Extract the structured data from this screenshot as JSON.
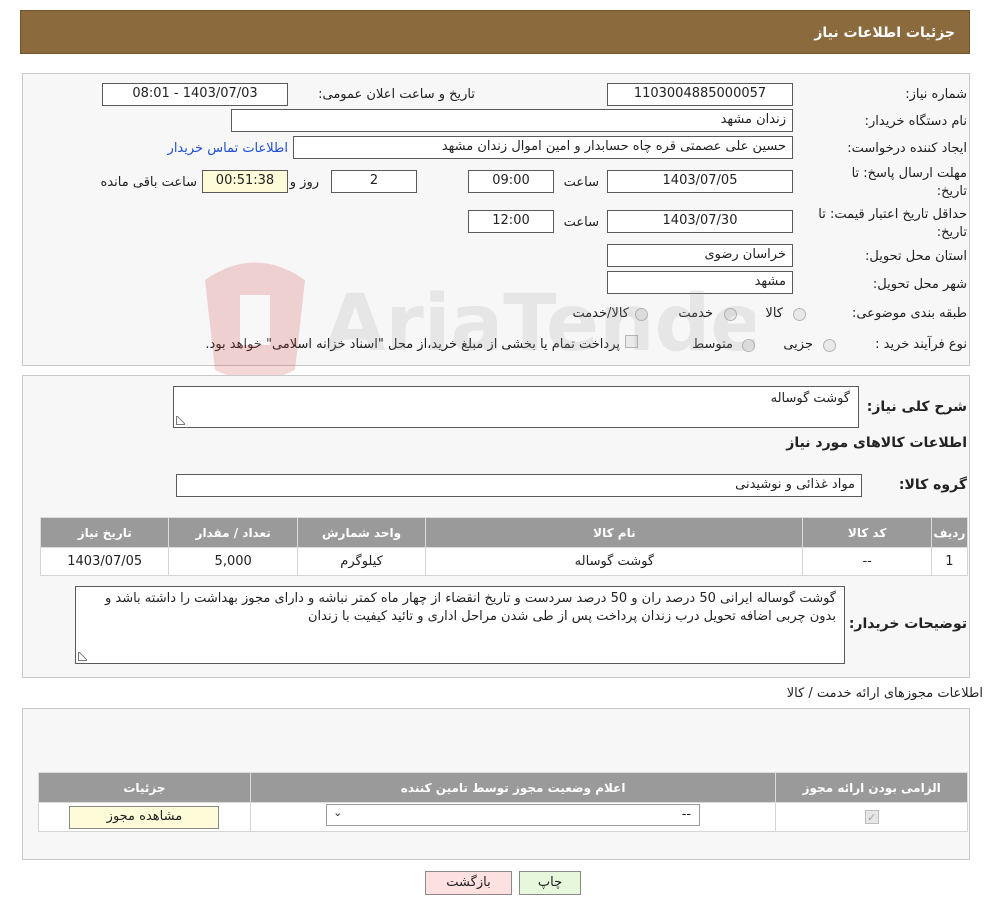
{
  "header": {
    "title": "جزئیات اطلاعات نیاز"
  },
  "form": {
    "need_number_label": "شماره نیاز:",
    "need_number": "1103004885000057",
    "announce_label": "تاریخ و ساعت اعلان عمومی:",
    "announce_value": "1403/07/03 - 08:01",
    "buyer_org_label": "نام دستگاه خریدار:",
    "buyer_org": "زندان مشهد",
    "requester_label": "ایجاد کننده درخواست:",
    "requester": "حسین علی عصمتی قره چاه حسابدار و امین اموال زندان مشهد",
    "contact_link": "اطلاعات تماس خریدار",
    "deadline_label_1": "مهلت ارسال پاسخ: تا",
    "deadline_label_2": "تاریخ:",
    "deadline_date": "1403/07/05",
    "hour_label": "ساعت",
    "deadline_time": "09:00",
    "days_value": "2",
    "days_label": "روز و",
    "remaining_time": "00:51:38",
    "remaining_label": "ساعت باقی مانده",
    "validity_label_1": "حداقل تاریخ اعتبار قیمت: تا",
    "validity_label_2": "تاریخ:",
    "validity_date": "1403/07/30",
    "validity_time": "12:00",
    "province_label": "استان محل تحویل:",
    "province": "خراسان رضوی",
    "city_label": "شهر محل تحویل:",
    "city": "مشهد",
    "category_label": "طبقه بندی موضوعی:",
    "category_options": [
      "کالا",
      "خدمت",
      "کالا/خدمت"
    ],
    "process_label": "نوع فرآیند خرید :",
    "process_options": [
      "جزیی",
      "متوسط"
    ],
    "payment_note": "پرداخت تمام یا بخشی از مبلغ خرید،از محل \"اسناد خزانه اسلامی\" خواهد بود."
  },
  "description": {
    "summary_label": "شرح کلی نیاز:",
    "summary": "گوشت گوساله",
    "goods_info_title": "اطلاعات کالاهای مورد نیاز",
    "group_label": "گروه کالا:",
    "group": "مواد غذائی و نوشیدنی",
    "table_headers": [
      "ردیف",
      "کد کالا",
      "نام کالا",
      "واحد شمارش",
      "تعداد / مقدار",
      "تاریخ نیاز"
    ],
    "rows": [
      [
        "1",
        "--",
        "گوشت گوساله",
        "کیلوگرم",
        "5,000",
        "1403/07/05"
      ]
    ],
    "buyer_notes_label": "توضیحات خریدار:",
    "buyer_notes": "گوشت گوساله ایرانی 50 درصد ران و 50 درصد سردست و تاریخ انقضاء از چهار ماه کمتر نباشه و دارای مجوز بهداشت را داشته باشد و بدون چربی اضافه تحویل درب زندان پرداخت پس از طی شدن مراحل اداری و تائید کیفیت با زندان"
  },
  "licenses": {
    "title": "اطلاعات مجوزهای ارائه خدمت / کالا",
    "headers": [
      "الزامی بودن ارائه مجوز",
      "اعلام وضعیت مجوز توسط تامین کننده",
      "جزئیات"
    ],
    "select_value": "--",
    "view_button": "مشاهده مجوز"
  },
  "buttons": {
    "print": "چاپ",
    "back": "بازگشت"
  },
  "watermark": {
    "text": "AriaTender.neT"
  },
  "colors": {
    "header_bg": "#8b6b3e",
    "link": "#1f4fd6",
    "table_header": "#9a9a9a"
  }
}
